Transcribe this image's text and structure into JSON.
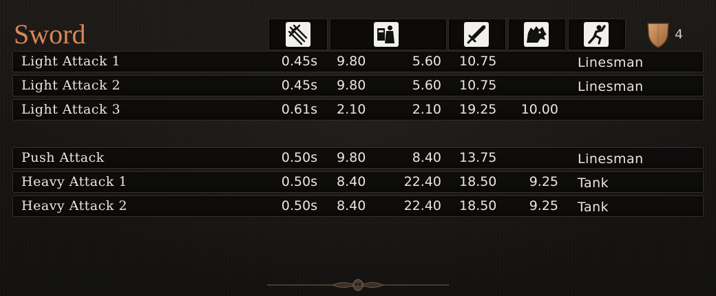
{
  "title": "Sword",
  "header_icons": {
    "attack_speed": "multi-swords-icon",
    "cleave": "stagger-cleave-icon",
    "damage": "sword-icon",
    "boss": "boss-beast-icon",
    "type": "runner-icon",
    "tier": "shield-icon"
  },
  "tier_value": "4",
  "rows": [
    {
      "name": "Light Attack 1",
      "time": "0.45s",
      "cleave": "9.80",
      "stagger": "5.60",
      "damage": "10.75",
      "boss": "",
      "type": "Linesman"
    },
    {
      "name": "Light Attack 2",
      "time": "0.45s",
      "cleave": "9.80",
      "stagger": "5.60",
      "damage": "10.75",
      "boss": "",
      "type": "Linesman"
    },
    {
      "name": "Light Attack 3",
      "time": "0.61s",
      "cleave": "2.10",
      "stagger": "2.10",
      "damage": "19.25",
      "boss": "10.00",
      "type": ""
    },
    {
      "name": "Push Attack",
      "time": "0.50s",
      "cleave": "9.80",
      "stagger": "8.40",
      "damage": "13.75",
      "boss": "",
      "type": "Linesman"
    },
    {
      "name": "Heavy Attack 1",
      "time": "0.50s",
      "cleave": "8.40",
      "stagger": "22.40",
      "damage": "18.50",
      "boss": "9.25",
      "type": "Tank"
    },
    {
      "name": "Heavy Attack 2",
      "time": "0.50s",
      "cleave": "8.40",
      "stagger": "22.40",
      "damage": "18.50",
      "boss": "9.25",
      "type": "Tank"
    }
  ],
  "colors": {
    "title": "#d9865a",
    "text": "#ece6dc",
    "background": "#171513",
    "row_border": "#34302b"
  }
}
